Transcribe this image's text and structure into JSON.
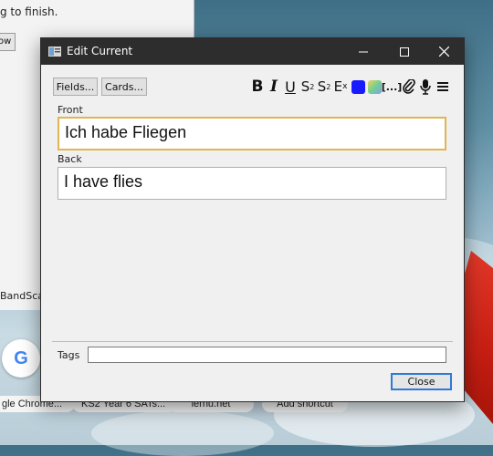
{
  "background_app": {
    "text": "g to finish.",
    "button_fragment": "ow",
    "label_fragment": "BandScap"
  },
  "browser_shortcuts": [
    {
      "label": "gle Chrome..."
    },
    {
      "label": "KS2 Year 6 SATs..."
    },
    {
      "label": "lernu.net"
    },
    {
      "label": "Add shortcut"
    }
  ],
  "google_tile": {
    "letter": "G"
  },
  "dialog": {
    "title": "Edit Current",
    "fields_button": "Fields...",
    "cards_button": "Cards...",
    "toolbar_icons": [
      "bold-icon",
      "italic-icon",
      "underline-icon",
      "superscript-icon",
      "subscript-icon",
      "clear-format-icon",
      "text-color-icon",
      "highlight-color-icon",
      "cloze-icon",
      "attach-icon",
      "record-audio-icon",
      "more-menu-icon"
    ],
    "front_label": "Front",
    "front_value": "Ich habe Fliegen",
    "back_label": "Back",
    "back_value": "I have flies",
    "tags_label": "Tags",
    "tags_value": "",
    "close_button": "Close",
    "colors": {
      "text_color": "#1a1aff",
      "focus_border": "#e0b552",
      "close_border": "#2f7ad6"
    }
  }
}
